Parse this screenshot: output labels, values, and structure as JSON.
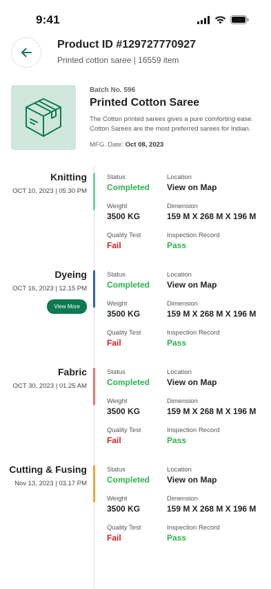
{
  "status_bar": {
    "time": "9:41"
  },
  "header": {
    "title": "Product ID #129727770927",
    "subtitle": "Printed cotton saree | 16559 item"
  },
  "product": {
    "batch": "Batch No. 596",
    "name": "Printed Cotton Saree",
    "description": "The Cotton printed sarees gives a pure comforting ease. Cotton Sarees are the most preferred sarees for Indian.",
    "mfg_label": "MFG. Date:",
    "mfg_date": "Oct 08, 2023",
    "image_icon": "box-icon",
    "image_bg": "#cfe6dc"
  },
  "labels": {
    "status": "Status",
    "location": "Location",
    "weight": "Weight",
    "dimension": "Dimension",
    "quality_test": "Quality Test",
    "inspection_record": "Inspection Record"
  },
  "stages": [
    {
      "name": "Knitting",
      "date": "OCT 10, 2023 | 05.30 PM",
      "bar_color": "#6fd39a",
      "status": "Completed",
      "location": "View on Map",
      "weight": "3500 KG",
      "dimension": "159 M X 268 M X 196 M",
      "quality": "Fail",
      "inspection": "Pass"
    },
    {
      "name": "Dyeing",
      "date": "OCT 16, 2023 | 12.15 PM",
      "bar_color": "#2f5fbf",
      "button": "View More",
      "status": "Completed",
      "location": "View on Map",
      "weight": "3500 KG",
      "dimension": "159 M X 268 M X 196 M",
      "quality": "Fail",
      "inspection": "Pass"
    },
    {
      "name": "Fabric",
      "date": "OCT 30, 2023 | 01.25 AM",
      "bar_color": "#ef7468",
      "status": "Completed",
      "location": "View on Map",
      "weight": "3500 KG",
      "dimension": "159 M X 268 M X 196 M",
      "quality": "Fail",
      "inspection": "Pass"
    },
    {
      "name": "Cutting & Fusing",
      "date": "Nov 13, 2023 | 03.17 PM",
      "bar_color": "#f2a23a",
      "status": "Completed",
      "location": "View on Map",
      "weight": "3500 KG",
      "dimension": "159 M X 268 M X 196 M",
      "quality": "Fail",
      "inspection": "Pass"
    }
  ],
  "colors": {
    "accent": "#0d7a4f",
    "pass": "#2bb24c",
    "fail": "#d7201f"
  }
}
